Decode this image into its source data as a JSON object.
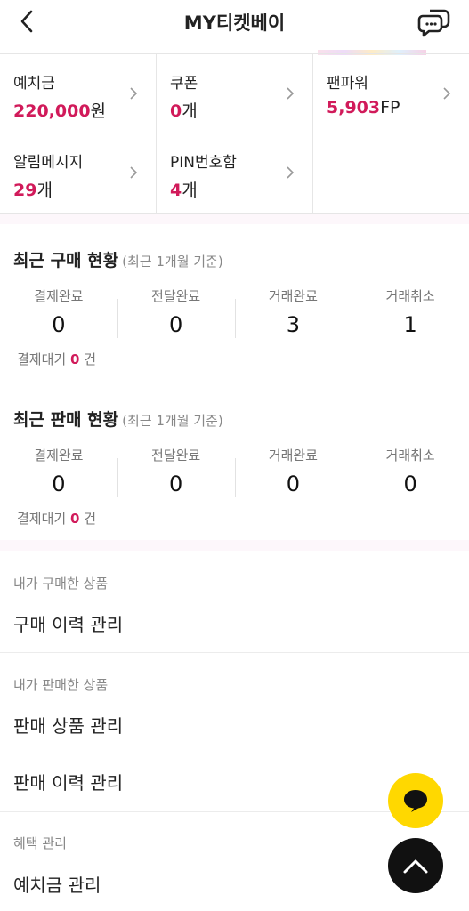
{
  "header": {
    "title": "MY티켓베이"
  },
  "icons": {
    "back": "back-arrow-icon",
    "chat": "chat-bubbles-icon",
    "chevron": "chevron-right-icon",
    "fab_chat": "chat-bubble-icon",
    "fab_top": "arrow-up-icon"
  },
  "colors": {
    "accent": "#d11a5a",
    "fab_chat_bg": "#ffd800",
    "fab_top_bg": "#111111"
  },
  "summary": [
    {
      "label": "예치금",
      "value": "220,000",
      "unit": "원"
    },
    {
      "label": "쿠폰",
      "value": "0",
      "unit": "개"
    },
    {
      "label": "팬파워",
      "value": "5,903",
      "unit": "FP"
    },
    {
      "label": "알림메시지",
      "value": "29",
      "unit": "개"
    },
    {
      "label": "PIN번호함",
      "value": "4",
      "unit": "개"
    }
  ],
  "purchase": {
    "title": "최근 구매 현황",
    "subtitle": "(최근 1개월 기준)",
    "stats": [
      {
        "label": "결제완료",
        "value": "0"
      },
      {
        "label": "전달완료",
        "value": "0"
      },
      {
        "label": "거래완료",
        "value": "3"
      },
      {
        "label": "거래취소",
        "value": "1"
      }
    ],
    "pending_label": "결제대기",
    "pending_value": "0",
    "pending_unit": "건"
  },
  "sales": {
    "title": "최근 판매 현황",
    "subtitle": "(최근 1개월 기준)",
    "stats": [
      {
        "label": "결제완료",
        "value": "0"
      },
      {
        "label": "전달완료",
        "value": "0"
      },
      {
        "label": "거래완료",
        "value": "0"
      },
      {
        "label": "거래취소",
        "value": "0"
      }
    ],
    "pending_label": "결제대기",
    "pending_value": "0",
    "pending_unit": "건"
  },
  "menu": {
    "bought_caption": "내가 구매한 상품",
    "purchase_history": "구매 이력 관리",
    "sold_caption": "내가 판매한 상품",
    "sale_items": "판매 상품 관리",
    "sale_history": "판매 이력 관리",
    "benefit_caption": "혜택 관리",
    "deposit": "예치금 관리"
  }
}
